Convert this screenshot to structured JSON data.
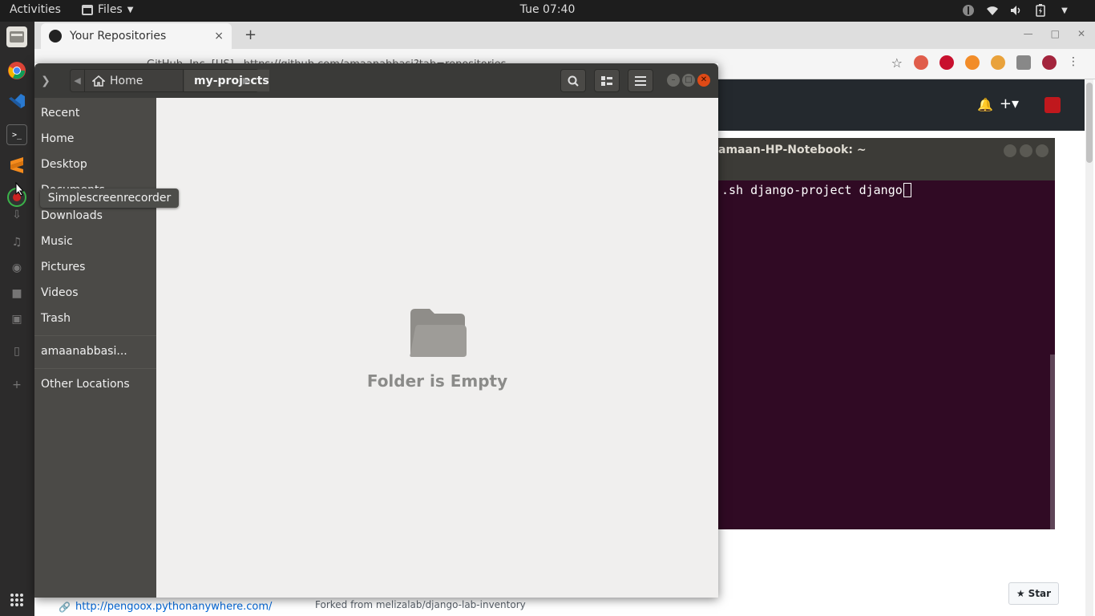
{
  "topbar": {
    "activities": "Activities",
    "app_name": "Files",
    "clock": "Tue 07:40"
  },
  "browser": {
    "tab_title": "Your Repositories",
    "tab_close": "×",
    "new_tab": "+",
    "url_org": "GitHub, Inc. [US]",
    "url": "https://github.com/amaanabbasi?tab=repositories",
    "repo_link": "http://pengoox.pythonanywhere.com/",
    "forked_from": "Forked from melizalab/django-lab-inventory",
    "star_label": "Star"
  },
  "terminal": {
    "title": "amaan-HP-Notebook: ~",
    "command": ".sh django-project django"
  },
  "files": {
    "breadcrumb_home": "Home",
    "breadcrumb_current": "my-projects",
    "sidebar": [
      {
        "label": "Recent"
      },
      {
        "label": "Home"
      },
      {
        "label": "Desktop"
      },
      {
        "label": "Documents"
      },
      {
        "label": "Downloads"
      },
      {
        "label": "Music"
      },
      {
        "label": "Pictures"
      },
      {
        "label": "Videos"
      },
      {
        "label": "Trash"
      },
      {
        "label": "amaanabbasi..."
      },
      {
        "label": "Other Locations"
      }
    ],
    "empty_message": "Folder is Empty"
  },
  "tooltip": "Simplescreenrecorder",
  "colors": {
    "topbar": "#1d1d1d",
    "dock": "#2c2b2b",
    "files_header": "#3a3a38",
    "files_sidebar": "#4b4a47",
    "files_main": "#f0efee",
    "terminal_bg": "#300a24",
    "close_button": "#df4a16",
    "github_header": "#24292e"
  }
}
